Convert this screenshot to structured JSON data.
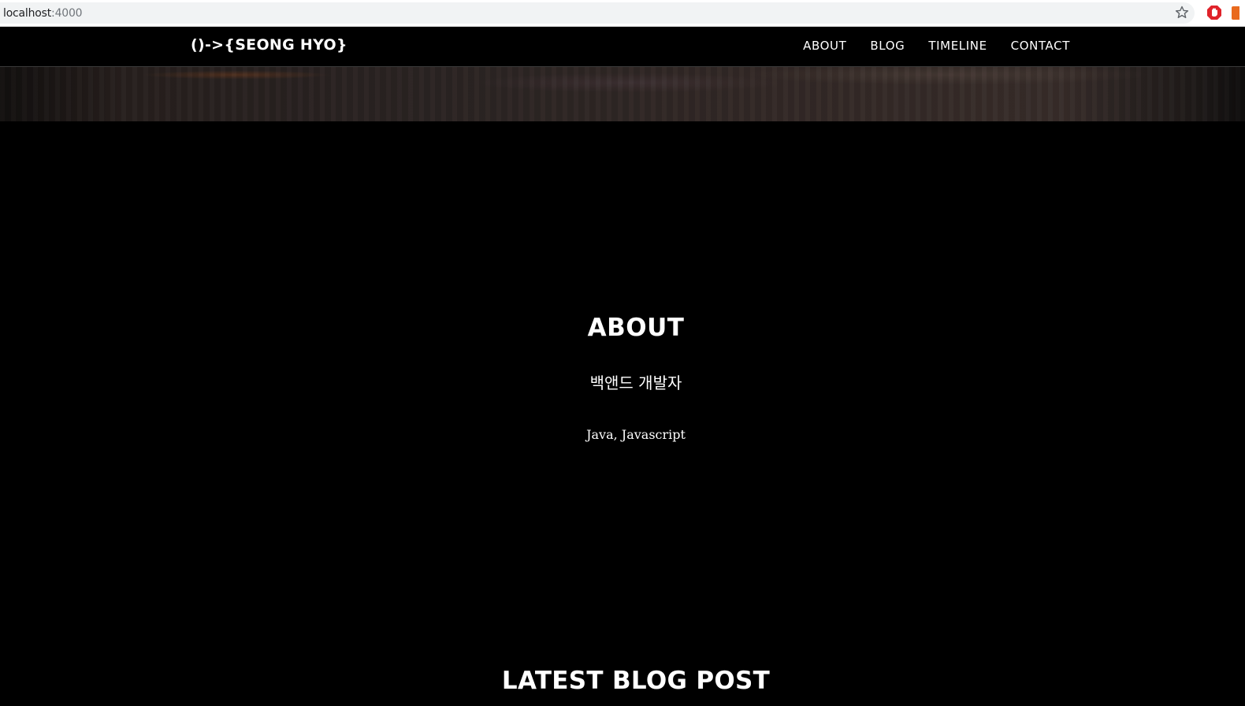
{
  "browser": {
    "url_host": "localhost",
    "url_port": ":4000"
  },
  "nav": {
    "brand": "()->{SEONG HYO}",
    "links": [
      "ABOUT",
      "BLOG",
      "TIMELINE",
      "CONTACT"
    ]
  },
  "about": {
    "title": "ABOUT",
    "subtitle": "백앤드 개발자",
    "skills": "Java, Javascript"
  },
  "blog": {
    "title": "LATEST BLOG POST"
  }
}
